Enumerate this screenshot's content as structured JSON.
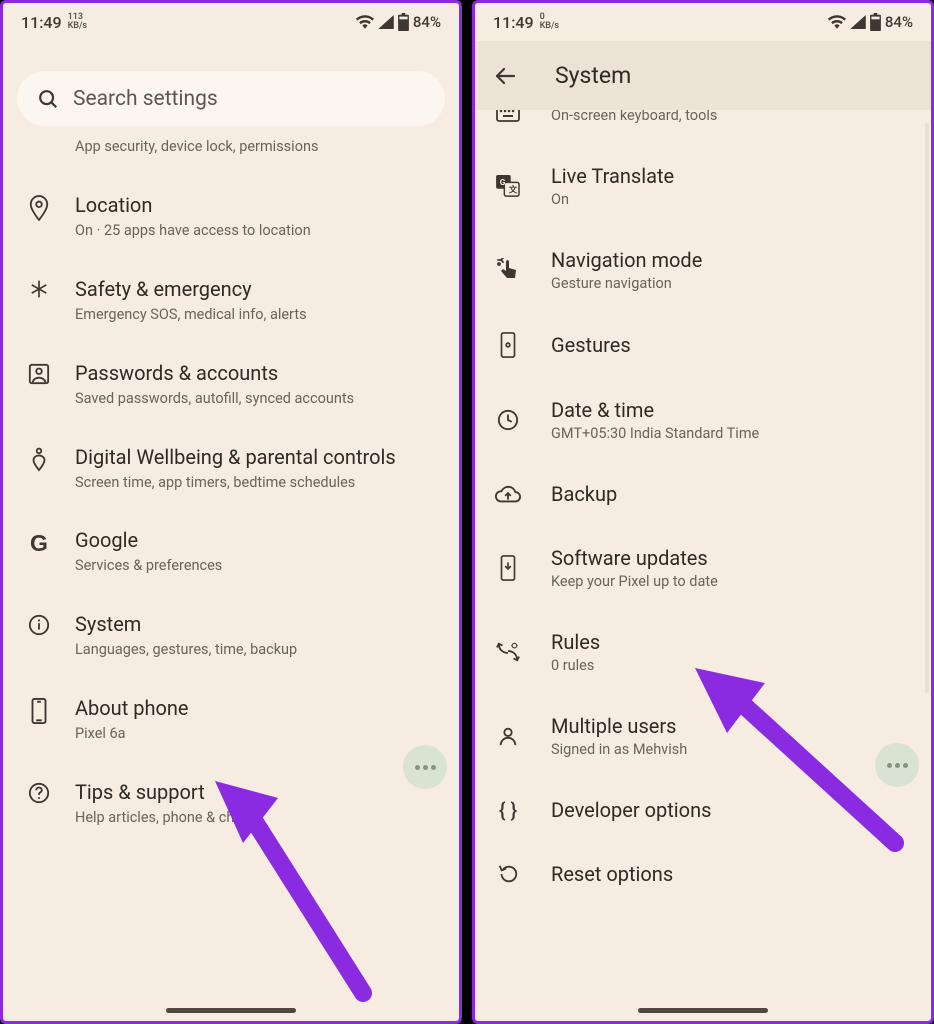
{
  "status": {
    "time": "11:49",
    "net_value": "113",
    "net_unit": "KB/s",
    "net_value2": "0",
    "battery": "84%"
  },
  "left": {
    "search_placeholder": "Search settings",
    "top_remnant": "App security, device lock, permissions",
    "items": [
      {
        "title": "Location",
        "sub": "On · 25 apps have access to location"
      },
      {
        "title": "Safety & emergency",
        "sub": "Emergency SOS, medical info, alerts"
      },
      {
        "title": "Passwords & accounts",
        "sub": "Saved passwords, autofill, synced accounts"
      },
      {
        "title": "Digital Wellbeing & parental controls",
        "sub": "Screen time, app timers, bedtime schedules"
      },
      {
        "title": "Google",
        "sub": "Services & preferences"
      },
      {
        "title": "System",
        "sub": "Languages, gestures, time, backup"
      },
      {
        "title": "About phone",
        "sub": "Pixel 6a"
      },
      {
        "title": "Tips & support",
        "sub": "Help articles, phone & chat"
      }
    ]
  },
  "right": {
    "header": "System",
    "top_remnant": "On-screen keyboard, tools",
    "items": [
      {
        "title": "Live Translate",
        "sub": "On"
      },
      {
        "title": "Navigation mode",
        "sub": "Gesture navigation"
      },
      {
        "title": "Gestures",
        "sub": ""
      },
      {
        "title": "Date & time",
        "sub": "GMT+05:30 India Standard Time"
      },
      {
        "title": "Backup",
        "sub": ""
      },
      {
        "title": "Software updates",
        "sub": "Keep your Pixel up to date"
      },
      {
        "title": "Rules",
        "sub": "0 rules"
      },
      {
        "title": "Multiple users",
        "sub": "Signed in as Mehvish"
      },
      {
        "title": "Developer options",
        "sub": ""
      },
      {
        "title": "Reset options",
        "sub": ""
      }
    ]
  }
}
